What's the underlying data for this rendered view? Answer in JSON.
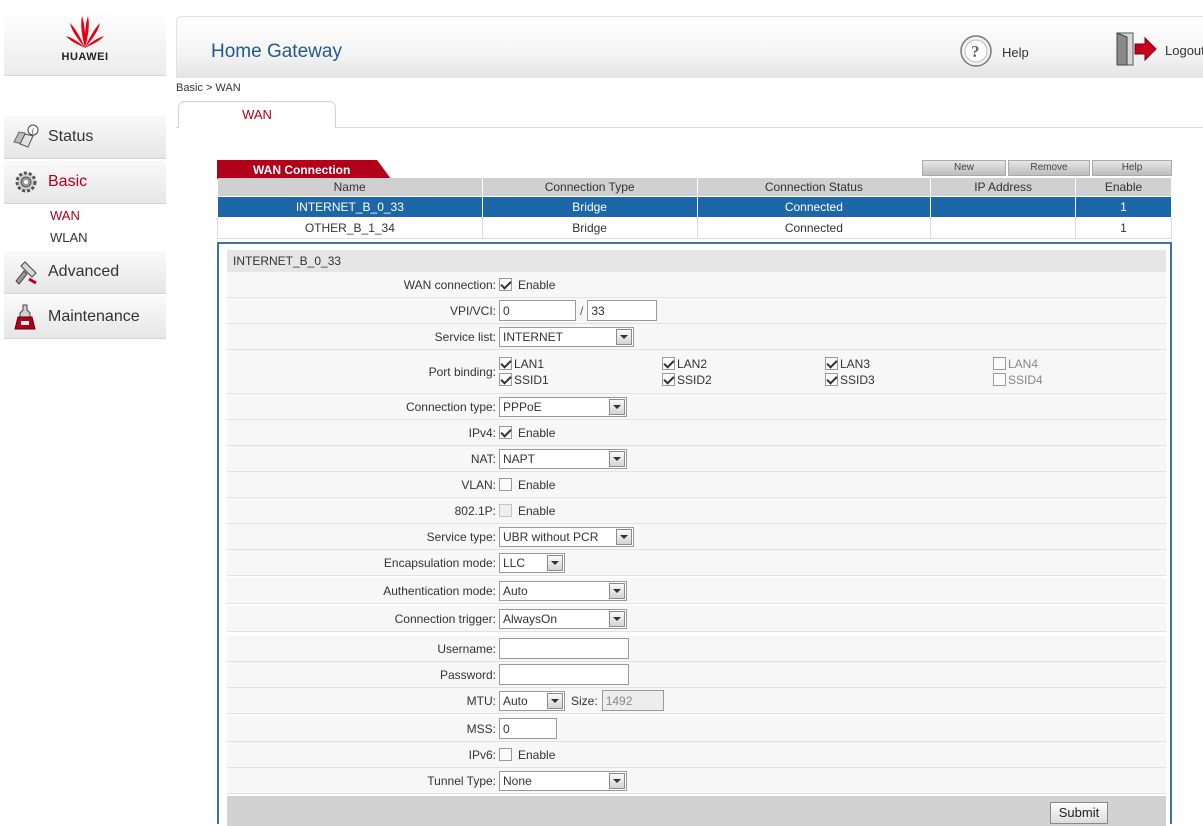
{
  "brand": {
    "logo_text": "HUAWEI",
    "color": "#e60012"
  },
  "header": {
    "title": "Home Gateway",
    "help": "Help",
    "logout": "Logout"
  },
  "sidebar": {
    "items": [
      {
        "label": "Status",
        "icon": "status-icon"
      },
      {
        "label": "Basic",
        "icon": "basic-gear-icon",
        "active": true,
        "sub": [
          {
            "label": "WAN",
            "active": true
          },
          {
            "label": "WLAN"
          }
        ]
      },
      {
        "label": "Advanced",
        "icon": "advanced-icon"
      },
      {
        "label": "Maintenance",
        "icon": "maintenance-icon"
      }
    ]
  },
  "breadcrumb": "Basic > WAN",
  "tabs": [
    {
      "label": "WAN",
      "active": true
    }
  ],
  "wan_table": {
    "tab_label": "WAN Connection",
    "buttons": {
      "new": "New",
      "remove": "Remove",
      "help": "Help"
    },
    "columns": [
      "Name",
      "Connection Type",
      "Connection Status",
      "IP Address",
      "Enable"
    ],
    "rows": [
      [
        "INTERNET_B_0_33",
        "Bridge",
        "Connected",
        "",
        "1"
      ],
      [
        "OTHER_B_1_34",
        "Bridge",
        "Connected",
        "",
        "1"
      ]
    ],
    "selected_row": 0
  },
  "form": {
    "title": "INTERNET_B_0_33",
    "wan_connection": {
      "label": "WAN connection:",
      "checkbox_label": "Enable",
      "checked": true
    },
    "vpi_vci": {
      "label": "VPI/VCI:",
      "vpi": "0",
      "separator": "/",
      "vci": "33"
    },
    "service_list": {
      "label": "Service list:",
      "value": "INTERNET"
    },
    "port_binding": {
      "label": "Port binding:",
      "ports": [
        {
          "label": "LAN1",
          "checked": true
        },
        {
          "label": "LAN2",
          "checked": true
        },
        {
          "label": "LAN3",
          "checked": true
        },
        {
          "label": "LAN4",
          "checked": false
        },
        {
          "label": "SSID1",
          "checked": true
        },
        {
          "label": "SSID2",
          "checked": true
        },
        {
          "label": "SSID3",
          "checked": true
        },
        {
          "label": "SSID4",
          "checked": false
        }
      ]
    },
    "connection_type": {
      "label": "Connection type:",
      "value": "PPPoE"
    },
    "ipv4": {
      "label": "IPv4:",
      "checkbox_label": "Enable",
      "checked": true
    },
    "nat": {
      "label": "NAT:",
      "value": "NAPT"
    },
    "vlan": {
      "label": "VLAN:",
      "checkbox_label": "Enable",
      "checked": false
    },
    "dot1p": {
      "label": "802.1P:",
      "checkbox_label": "Enable",
      "checked": false,
      "disabled": true
    },
    "service_type": {
      "label": "Service type:",
      "value": "UBR without PCR"
    },
    "encapsulation_mode": {
      "label": "Encapsulation mode:",
      "value": "LLC"
    },
    "authentication_mode": {
      "label": "Authentication mode:",
      "value": "Auto"
    },
    "connection_trigger": {
      "label": "Connection trigger:",
      "value": "AlwaysOn"
    },
    "username": {
      "label": "Username:",
      "value": ""
    },
    "password": {
      "label": "Password:",
      "value": ""
    },
    "mtu": {
      "label": "MTU:",
      "value": "Auto",
      "size_label": "Size:",
      "size_value": "1492"
    },
    "mss": {
      "label": "MSS:",
      "value": "0"
    },
    "ipv6": {
      "label": "IPv6:",
      "checkbox_label": "Enable",
      "checked": false
    },
    "tunnel_type": {
      "label": "Tunnel Type:",
      "value": "None"
    },
    "submit": "Submit"
  }
}
